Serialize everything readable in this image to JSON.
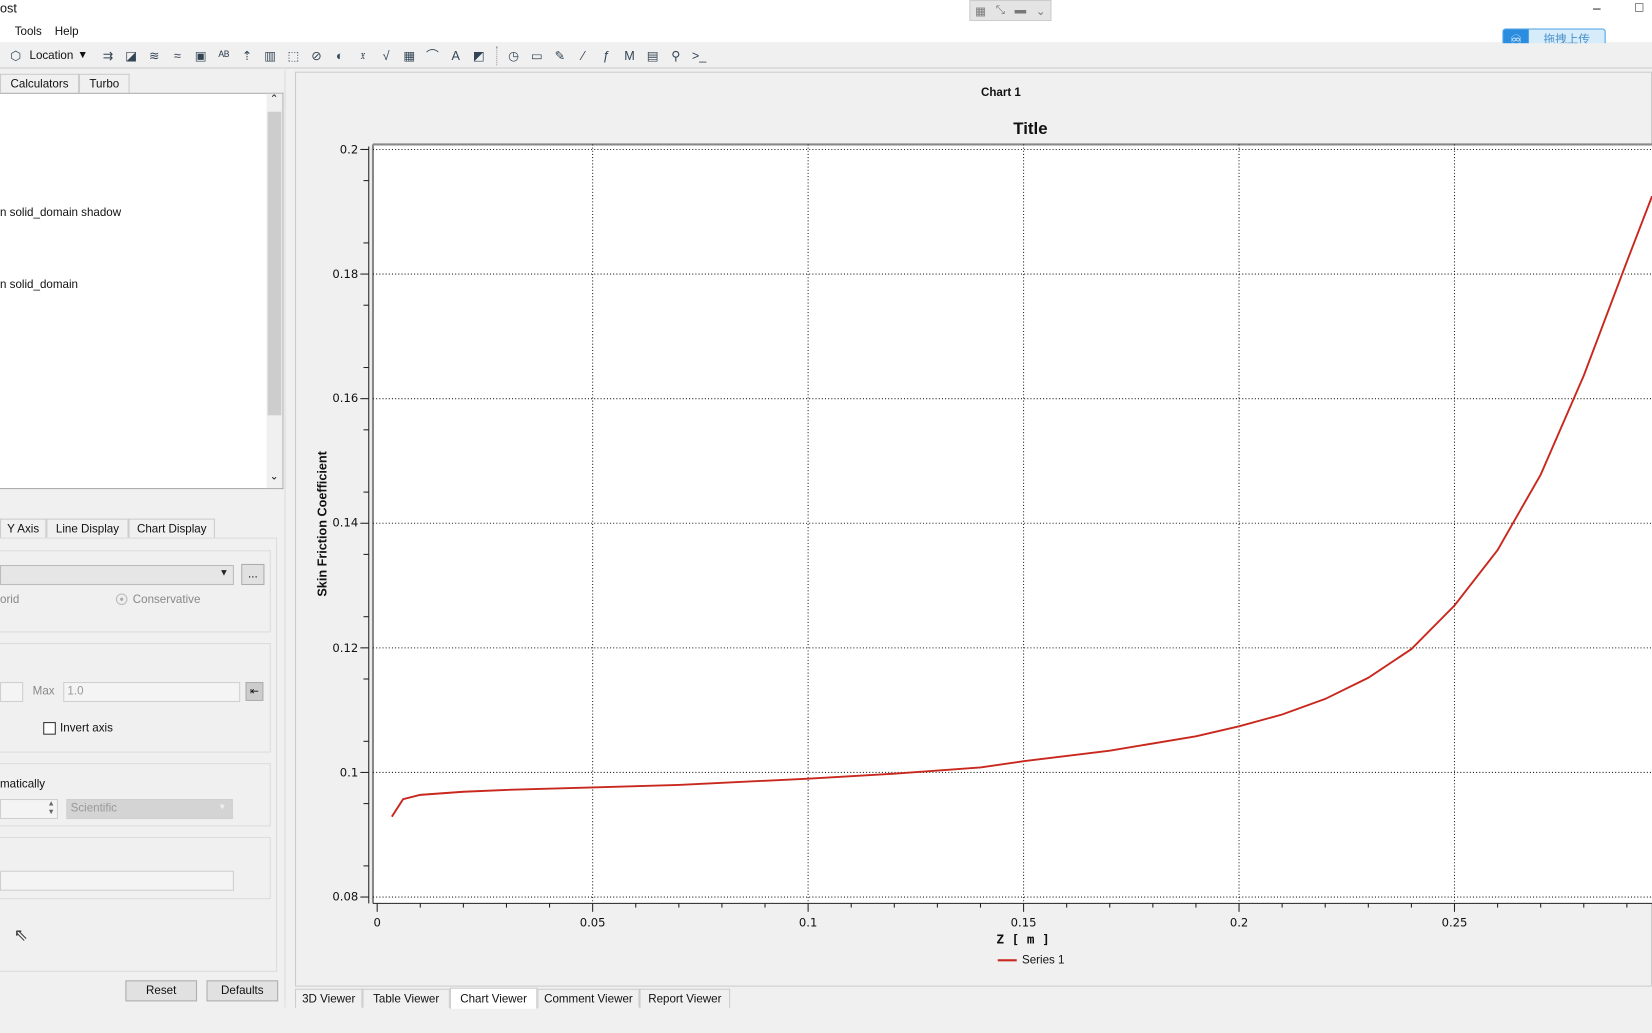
{
  "window": {
    "title": "ost",
    "upload_label": "拖拽上传",
    "minimize": "–",
    "maximize": "□"
  },
  "menu": [
    "Tools",
    "Help"
  ],
  "toolbar": {
    "location_label": "Location",
    "icons": [
      "arrows-icon",
      "contour-icon",
      "streamline-icon",
      "flow-icon",
      "volume-icon",
      "text-abc-icon",
      "vector-icon",
      "legend-icon",
      "clip-icon",
      "isosurface-icon",
      "color-icon",
      "variable-icon",
      "expression-icon",
      "table-icon",
      "chart-icon",
      "text-icon",
      "mesh-icon",
      "clock-icon",
      "animation-icon",
      "edit-icon",
      "probe-icon",
      "function-icon",
      "macro-icon",
      "report-icon",
      "compare-icon",
      "console-icon"
    ],
    "glyphs": [
      "⇉",
      "◪",
      "≋",
      "≈",
      "▣",
      "ᴬᴮ",
      "⇡",
      "▥",
      "⬚",
      "⊘",
      "◐",
      "𝔵",
      "√",
      "▦",
      "⌒",
      "A",
      "◩",
      "◷",
      "▭",
      "✎",
      "⁄",
      "ƒ",
      "M",
      "▤",
      "⚲",
      ">_"
    ]
  },
  "left_panel": {
    "top_tabs": [
      "Calculators",
      "Turbo"
    ],
    "list_items": [
      "n solid_domain shadow",
      "n solid_domain"
    ],
    "sub_tabs": [
      "Y Axis",
      "Line Display",
      "Chart Display"
    ],
    "more_button": "...",
    "hybrid_label": "orid",
    "conservative_label": "Conservative",
    "max_label": "Max",
    "max_value": "1.0",
    "invert_axis_label": "Invert axis",
    "invert_axis_checked": false,
    "auto_label": "matically",
    "format_select": "Scientific",
    "reset_label": "Reset",
    "defaults_label": "Defaults"
  },
  "chart_view": {
    "name": "Chart 1"
  },
  "bottom_tabs": [
    "3D Viewer",
    "Table Viewer",
    "Chart Viewer",
    "Comment Viewer",
    "Report Viewer"
  ],
  "active_bottom_tab": "Chart Viewer",
  "chart_data": {
    "type": "line",
    "title": "Title",
    "xlabel": "Z [ m ]",
    "ylabel": "Skin Friction Coefficient",
    "xlim": [
      0,
      0.296
    ],
    "ylim": [
      0.08,
      0.2
    ],
    "xticks": [
      "0",
      "0.05",
      "0.1",
      "0.15",
      "0.2",
      "0.25"
    ],
    "yticks": [
      "0.08",
      "0.1",
      "0.12",
      "0.14",
      "0.16",
      "0.18",
      "0.2"
    ],
    "grid": true,
    "legend": "bottom-center",
    "series": [
      {
        "name": "Series 1",
        "color": "#c8281e",
        "x": [
          0.0034,
          0.006,
          0.01,
          0.02,
          0.03,
          0.05,
          0.07,
          0.1,
          0.12,
          0.14,
          0.15,
          0.17,
          0.19,
          0.2,
          0.21,
          0.22,
          0.23,
          0.24,
          0.25,
          0.26,
          0.27,
          0.28,
          0.29,
          0.296
        ],
        "y": [
          0.0929,
          0.0957,
          0.0964,
          0.0969,
          0.0972,
          0.0976,
          0.098,
          0.099,
          0.0998,
          0.1008,
          0.1018,
          0.1035,
          0.1058,
          0.1074,
          0.1093,
          0.1118,
          0.1152,
          0.1198,
          0.1268,
          0.1357,
          0.1478,
          0.1637,
          0.182,
          0.1925
        ]
      }
    ]
  }
}
